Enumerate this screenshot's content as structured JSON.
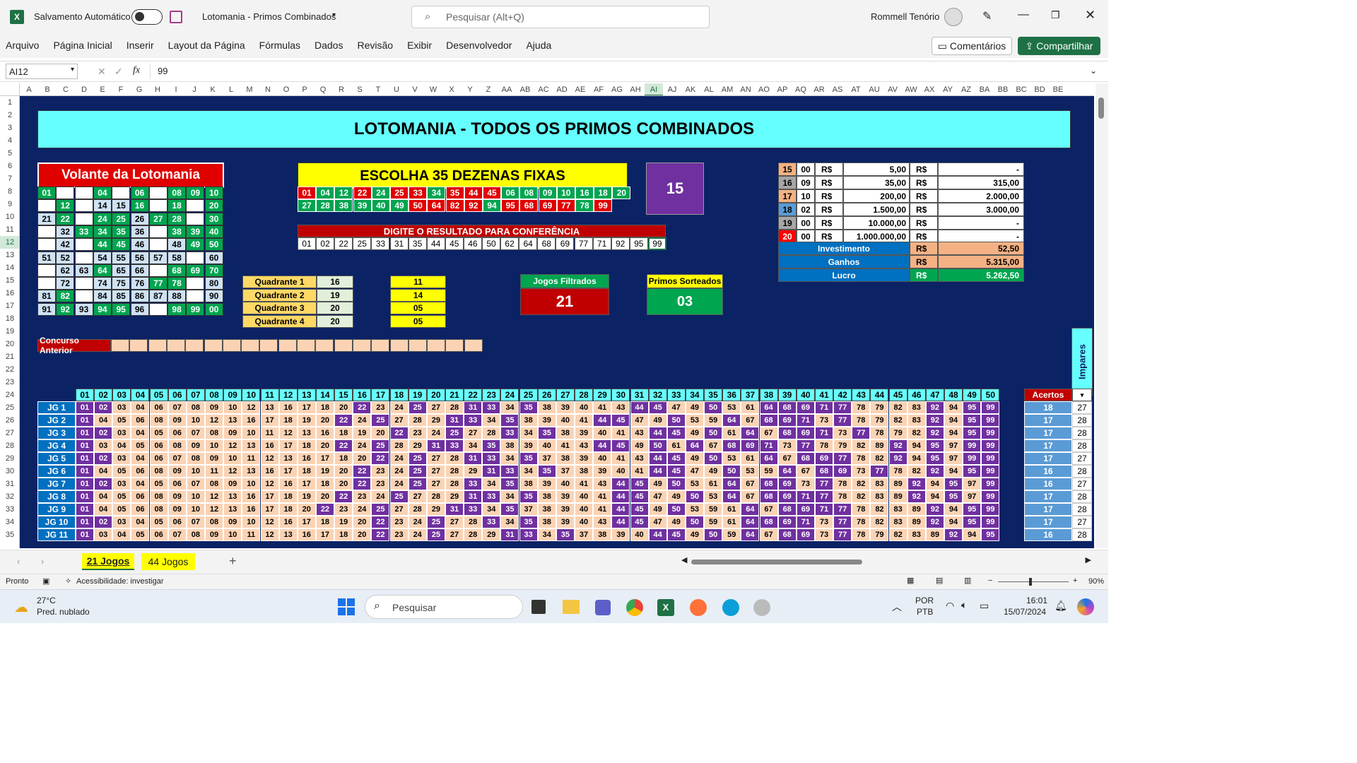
{
  "app": {
    "autosave_label": "Salvamento Automático",
    "file_title": "Lotomania - Primos Combinados",
    "search_placeholder": "Pesquisar (Alt+Q)",
    "user": "Rommell Tenório"
  },
  "menu": [
    "Arquivo",
    "Página Inicial",
    "Inserir",
    "Layout da Página",
    "Fórmulas",
    "Dados",
    "Revisão",
    "Exibir",
    "Desenvolvedor",
    "Ajuda"
  ],
  "actions": {
    "comments": "Comentários",
    "share": "Compartilhar"
  },
  "formula": {
    "cell_ref": "AI12",
    "fx": "fx",
    "value": "99"
  },
  "columns": [
    "A",
    "B",
    "C",
    "D",
    "E",
    "F",
    "G",
    "H",
    "I",
    "J",
    "K",
    "L",
    "M",
    "N",
    "O",
    "P",
    "Q",
    "R",
    "S",
    "T",
    "U",
    "V",
    "W",
    "X",
    "Y",
    "Z",
    "AA",
    "AB",
    "AC",
    "AD",
    "AE",
    "AF",
    "AG",
    "AH",
    "AI",
    "AJ",
    "AK",
    "AL",
    "AM",
    "AN",
    "AO",
    "AP",
    "AQ",
    "AR",
    "AS",
    "AT",
    "AU",
    "AV",
    "AW",
    "AX",
    "AY",
    "AZ",
    "BA",
    "BB",
    "BC",
    "BD",
    "BE"
  ],
  "rows": [
    "1",
    "2",
    "3",
    "4",
    "5",
    "6",
    "7",
    "8",
    "9",
    "10",
    "11",
    "12",
    "13",
    "14",
    "15",
    "16",
    "17",
    "18",
    "19",
    "20",
    "21",
    "22",
    "23",
    "24",
    "25",
    "26",
    "27",
    "28",
    "29",
    "30",
    "31",
    "32",
    "33",
    "34",
    "35"
  ],
  "sheet": {
    "title": "LOTOMANIA - TODOS OS PRIMOS COMBINADOS",
    "volante_title": "Volante da Lotomania",
    "volante": [
      [
        "01",
        "",
        "",
        "04",
        "",
        "06",
        "",
        "08",
        "09",
        "10"
      ],
      [
        "",
        "12",
        "",
        "14",
        "15",
        "16",
        "",
        "18",
        "",
        "20"
      ],
      [
        "21",
        "22",
        "",
        "24",
        "25",
        "26",
        "27",
        "28",
        "",
        "30"
      ],
      [
        "",
        "32",
        "33",
        "34",
        "35",
        "36",
        "",
        "38",
        "39",
        "40"
      ],
      [
        "",
        "42",
        "",
        "44",
        "45",
        "46",
        "",
        "48",
        "49",
        "50"
      ],
      [
        "51",
        "52",
        "",
        "54",
        "55",
        "56",
        "57",
        "58",
        "",
        "60"
      ],
      [
        "",
        "62",
        "63",
        "64",
        "65",
        "66",
        "",
        "68",
        "69",
        "70"
      ],
      [
        "",
        "72",
        "",
        "74",
        "75",
        "76",
        "77",
        "78",
        "",
        "80"
      ],
      [
        "81",
        "82",
        "",
        "84",
        "85",
        "86",
        "87",
        "88",
        "",
        "90"
      ],
      [
        "91",
        "92",
        "93",
        "94",
        "95",
        "96",
        "",
        "98",
        "99",
        "00"
      ]
    ],
    "escolha_title": "ESCOLHA 35 DEZENAS FIXAS",
    "escolha_row1": [
      "01",
      "04",
      "12",
      "22",
      "24",
      "25",
      "33",
      "34",
      "35",
      "44",
      "45",
      "06",
      "08",
      "09",
      "10",
      "16",
      "18",
      "20"
    ],
    "escolha_row2": [
      "27",
      "28",
      "38",
      "39",
      "40",
      "49",
      "50",
      "64",
      "82",
      "92",
      "94",
      "95",
      "68",
      "69",
      "77",
      "78",
      "99"
    ],
    "count_box": "15",
    "resultado_title": "DIGITE O RESULTADO PARA CONFERÊNCIA",
    "resultado": [
      "01",
      "02",
      "22",
      "25",
      "33",
      "31",
      "35",
      "44",
      "45",
      "46",
      "50",
      "62",
      "64",
      "68",
      "69",
      "77",
      "71",
      "92",
      "95",
      "99"
    ],
    "premios": [
      {
        "hits": "15",
        "games": "00",
        "cur": "R$",
        "prize": "5,00",
        "cur2": "R$",
        "total": "-"
      },
      {
        "hits": "16",
        "games": "09",
        "cur": "R$",
        "prize": "35,00",
        "cur2": "R$",
        "total": "315,00"
      },
      {
        "hits": "17",
        "games": "10",
        "cur": "R$",
        "prize": "200,00",
        "cur2": "R$",
        "total": "2.000,00"
      },
      {
        "hits": "18",
        "games": "02",
        "cur": "R$",
        "prize": "1.500,00",
        "cur2": "R$",
        "total": "3.000,00"
      },
      {
        "hits": "19",
        "games": "00",
        "cur": "R$",
        "prize": "10.000,00",
        "cur2": "R$",
        "total": "-"
      },
      {
        "hits": "20",
        "games": "00",
        "cur": "R$",
        "prize": "1.000.000,00",
        "cur2": "R$",
        "total": "-"
      }
    ],
    "summary": [
      {
        "label": "Investimento",
        "cur": "R$",
        "value": "52,50"
      },
      {
        "label": "Ganhos",
        "cur": "R$",
        "value": "5.315,00"
      },
      {
        "label": "Lucro",
        "cur": "R$",
        "value": "5.262,50"
      }
    ],
    "quadrantes": [
      {
        "label": "Quadrante 1",
        "a": "16",
        "b": "11"
      },
      {
        "label": "Quadrante 2",
        "a": "19",
        "b": "14"
      },
      {
        "label": "Quadrante 3",
        "a": "20",
        "b": "05"
      },
      {
        "label": "Quadrante 4",
        "a": "20",
        "b": "05"
      }
    ],
    "jogos_filtrados_label": "Jogos Filtrados",
    "jogos_filtrados": "21",
    "primos_sorteados_label": "Primos Sorteados",
    "primos_sorteados": "03",
    "concurso_anterior": "Concurso Anterior",
    "impares": "Impares",
    "acertos_label": "Acertos",
    "game_cols": [
      "01",
      "02",
      "03",
      "04",
      "05",
      "06",
      "07",
      "08",
      "09",
      "10",
      "11",
      "12",
      "13",
      "14",
      "15",
      "16",
      "17",
      "18",
      "19",
      "20",
      "21",
      "22",
      "23",
      "24",
      "25",
      "26",
      "27",
      "28",
      "29",
      "30",
      "31",
      "32",
      "33",
      "34",
      "35",
      "36",
      "37",
      "38",
      "39",
      "40",
      "41",
      "42",
      "43",
      "44",
      "45",
      "46",
      "47",
      "48",
      "49",
      "50"
    ],
    "games": [
      {
        "label": "JG 1",
        "nums": [
          "01",
          "02",
          "03",
          "04",
          "06",
          "07",
          "08",
          "09",
          "10",
          "12",
          "13",
          "16",
          "17",
          "18",
          "20",
          "22",
          "23",
          "24",
          "25",
          "27",
          "28",
          "31",
          "33",
          "34",
          "35",
          "38",
          "39",
          "40",
          "41",
          "43",
          "44",
          "45",
          "47",
          "49",
          "50",
          "53",
          "61",
          "64",
          "68",
          "69",
          "71",
          "77",
          "78",
          "79",
          "82",
          "83",
          "92",
          "94",
          "95",
          "99"
        ],
        "acertos": "18",
        "imp": "27"
      },
      {
        "label": "JG 2",
        "nums": [
          "01",
          "04",
          "05",
          "06",
          "08",
          "09",
          "10",
          "12",
          "13",
          "16",
          "17",
          "18",
          "19",
          "20",
          "22",
          "24",
          "25",
          "27",
          "28",
          "29",
          "31",
          "33",
          "34",
          "35",
          "38",
          "39",
          "40",
          "41",
          "44",
          "45",
          "47",
          "49",
          "50",
          "53",
          "59",
          "64",
          "67",
          "68",
          "69",
          "71",
          "73",
          "77",
          "78",
          "79",
          "82",
          "83",
          "92",
          "94",
          "95",
          "99"
        ],
        "acertos": "17",
        "imp": "28"
      },
      {
        "label": "JG 3",
        "nums": [
          "01",
          "02",
          "03",
          "04",
          "05",
          "06",
          "07",
          "08",
          "09",
          "10",
          "11",
          "12",
          "13",
          "16",
          "18",
          "19",
          "20",
          "22",
          "23",
          "24",
          "25",
          "27",
          "28",
          "33",
          "34",
          "35",
          "38",
          "39",
          "40",
          "41",
          "43",
          "44",
          "45",
          "49",
          "50",
          "61",
          "64",
          "67",
          "68",
          "69",
          "71",
          "73",
          "77",
          "78",
          "79",
          "82",
          "92",
          "94",
          "95",
          "99"
        ],
        "acertos": "17",
        "imp": "28"
      },
      {
        "label": "JG 4",
        "nums": [
          "01",
          "03",
          "04",
          "05",
          "06",
          "08",
          "09",
          "10",
          "12",
          "13",
          "16",
          "17",
          "18",
          "20",
          "22",
          "24",
          "25",
          "28",
          "29",
          "31",
          "33",
          "34",
          "35",
          "38",
          "39",
          "40",
          "41",
          "43",
          "44",
          "45",
          "49",
          "50",
          "61",
          "64",
          "67",
          "68",
          "69",
          "71",
          "73",
          "77",
          "78",
          "79",
          "82",
          "89",
          "92",
          "94",
          "95",
          "97",
          "99",
          "99"
        ],
        "acertos": "17",
        "imp": "28"
      },
      {
        "label": "JG 5",
        "nums": [
          "01",
          "02",
          "03",
          "04",
          "06",
          "07",
          "08",
          "09",
          "10",
          "11",
          "12",
          "13",
          "16",
          "17",
          "18",
          "20",
          "22",
          "24",
          "25",
          "27",
          "28",
          "31",
          "33",
          "34",
          "35",
          "37",
          "38",
          "39",
          "40",
          "41",
          "43",
          "44",
          "45",
          "49",
          "50",
          "53",
          "61",
          "64",
          "67",
          "68",
          "69",
          "77",
          "78",
          "82",
          "92",
          "94",
          "95",
          "97",
          "99",
          "99"
        ],
        "acertos": "17",
        "imp": "27"
      },
      {
        "label": "JG 6",
        "nums": [
          "01",
          "04",
          "05",
          "06",
          "08",
          "09",
          "10",
          "11",
          "12",
          "13",
          "16",
          "17",
          "18",
          "19",
          "20",
          "22",
          "23",
          "24",
          "25",
          "27",
          "28",
          "29",
          "31",
          "33",
          "34",
          "35",
          "37",
          "38",
          "39",
          "40",
          "41",
          "44",
          "45",
          "47",
          "49",
          "50",
          "53",
          "59",
          "64",
          "67",
          "68",
          "69",
          "73",
          "77",
          "78",
          "82",
          "92",
          "94",
          "95",
          "99"
        ],
        "acertos": "16",
        "imp": "28"
      },
      {
        "label": "JG 7",
        "nums": [
          "01",
          "02",
          "03",
          "04",
          "05",
          "06",
          "07",
          "08",
          "09",
          "10",
          "12",
          "16",
          "17",
          "18",
          "20",
          "22",
          "23",
          "24",
          "25",
          "27",
          "28",
          "33",
          "34",
          "35",
          "38",
          "39",
          "40",
          "41",
          "43",
          "44",
          "45",
          "49",
          "50",
          "53",
          "61",
          "64",
          "67",
          "68",
          "69",
          "73",
          "77",
          "78",
          "82",
          "83",
          "89",
          "92",
          "94",
          "95",
          "97",
          "99"
        ],
        "acertos": "16",
        "imp": "27"
      },
      {
        "label": "JG 8",
        "nums": [
          "01",
          "04",
          "05",
          "06",
          "08",
          "09",
          "10",
          "12",
          "13",
          "16",
          "17",
          "18",
          "19",
          "20",
          "22",
          "23",
          "24",
          "25",
          "27",
          "28",
          "29",
          "31",
          "33",
          "34",
          "35",
          "38",
          "39",
          "40",
          "41",
          "44",
          "45",
          "47",
          "49",
          "50",
          "53",
          "64",
          "67",
          "68",
          "69",
          "71",
          "77",
          "78",
          "82",
          "83",
          "89",
          "92",
          "94",
          "95",
          "97",
          "99"
        ],
        "acertos": "17",
        "imp": "28"
      },
      {
        "label": "JG 9",
        "nums": [
          "01",
          "04",
          "05",
          "06",
          "08",
          "09",
          "10",
          "12",
          "13",
          "16",
          "17",
          "18",
          "20",
          "22",
          "23",
          "24",
          "25",
          "27",
          "28",
          "29",
          "31",
          "33",
          "34",
          "35",
          "37",
          "38",
          "39",
          "40",
          "41",
          "44",
          "45",
          "49",
          "50",
          "53",
          "59",
          "61",
          "64",
          "67",
          "68",
          "69",
          "71",
          "77",
          "78",
          "82",
          "83",
          "89",
          "92",
          "94",
          "95",
          "99"
        ],
        "acertos": "17",
        "imp": "28"
      },
      {
        "label": "JG 10",
        "nums": [
          "01",
          "02",
          "03",
          "04",
          "05",
          "06",
          "07",
          "08",
          "09",
          "10",
          "12",
          "16",
          "17",
          "18",
          "19",
          "20",
          "22",
          "23",
          "24",
          "25",
          "27",
          "28",
          "33",
          "34",
          "35",
          "38",
          "39",
          "40",
          "43",
          "44",
          "45",
          "47",
          "49",
          "50",
          "59",
          "61",
          "64",
          "68",
          "69",
          "71",
          "73",
          "77",
          "78",
          "82",
          "83",
          "89",
          "92",
          "94",
          "95",
          "99"
        ],
        "acertos": "17",
        "imp": "27"
      },
      {
        "label": "JG 11",
        "nums": [
          "01",
          "03",
          "04",
          "05",
          "06",
          "07",
          "08",
          "09",
          "10",
          "11",
          "12",
          "13",
          "16",
          "17",
          "18",
          "20",
          "22",
          "23",
          "24",
          "25",
          "27",
          "28",
          "29",
          "31",
          "33",
          "34",
          "35",
          "37",
          "38",
          "39",
          "40",
          "44",
          "45",
          "49",
          "50",
          "59",
          "64",
          "67",
          "68",
          "69",
          "73",
          "77",
          "78",
          "79",
          "82",
          "83",
          "89",
          "92",
          "94",
          "95"
        ],
        "acertos": "16",
        "imp": "28"
      }
    ]
  },
  "tabs": {
    "active": "21 Jogos",
    "other": "44 Jogos",
    "add": "+"
  },
  "status": {
    "ready": "Pronto",
    "accessibility": "Acessibilidade: investigar",
    "zoom": "90%",
    "zoom_minus": "−",
    "zoom_plus": "+"
  },
  "taskbar": {
    "temp": "27°C",
    "weather": "Pred. nublado",
    "search": "Pesquisar",
    "lang1": "POR",
    "lang2": "PTB",
    "time": "16:01",
    "date": "15/07/2024"
  },
  "colors": {
    "navy": "#0b2265",
    "green": "#00a550",
    "red": "#e00000",
    "cyan": "#66ffff",
    "yellow": "#ffff00",
    "purple": "#7030a0",
    "peach": "#fbd3b4",
    "excel_green": "#1e7145"
  }
}
